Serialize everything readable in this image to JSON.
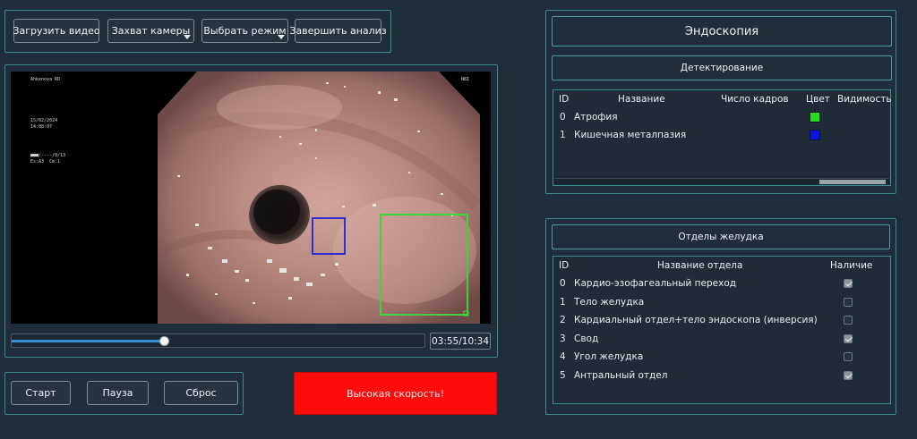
{
  "toolbar": {
    "load_video": "Загрузить видео",
    "camera_capture": "Захват камеры",
    "select_mode": "Выбрать режим",
    "finish_analysis": "Завершить анализ"
  },
  "video": {
    "overlay_top_left": "Ahkenova RD",
    "overlay_top_right": "NBI",
    "overlay_date": "15/02/2024",
    "overlay_time": "14:08:07",
    "overlay_info_1": "■■■/----/0/13",
    "overlay_info_2": "Es:A3  Cm:1",
    "time": "03:55/10:34",
    "progress": 0.37
  },
  "controls": {
    "start": "Старт",
    "pause": "Пауза",
    "reset": "Сброс",
    "alert": "Высокая скорость!"
  },
  "right": {
    "title": "Эндоскопия",
    "detection_title": "Детектирование",
    "detection_headers": {
      "id": "ID",
      "name": "Название",
      "frames": "Число кадров",
      "color": "Цвет",
      "visibility": "Видимость"
    },
    "detections": [
      {
        "id": "0",
        "name": "Атрофия",
        "color": "#22e01f"
      },
      {
        "id": "1",
        "name": "Кишечная металпазия",
        "color": "#0a12e6"
      }
    ],
    "stomach_title": "Отделы желудка",
    "stomach_headers": {
      "id": "ID",
      "name": "Название отдела",
      "presence": "Наличие"
    },
    "sections": [
      {
        "id": "0",
        "name": "Кардио-эзофагеальный переход",
        "present": true
      },
      {
        "id": "1",
        "name": "Тело желудка",
        "present": false
      },
      {
        "id": "2",
        "name": "Кардиальный отдел+тело эндоскопа (инверсия)",
        "present": false
      },
      {
        "id": "3",
        "name": "Свод",
        "present": true
      },
      {
        "id": "4",
        "name": "Угол желудка",
        "present": false
      },
      {
        "id": "5",
        "name": "Антральный отдел",
        "present": true
      }
    ]
  },
  "colors": {
    "accent": "#3e8a8f",
    "alert": "#ff0d0d",
    "progress": "#3b8fd6"
  }
}
